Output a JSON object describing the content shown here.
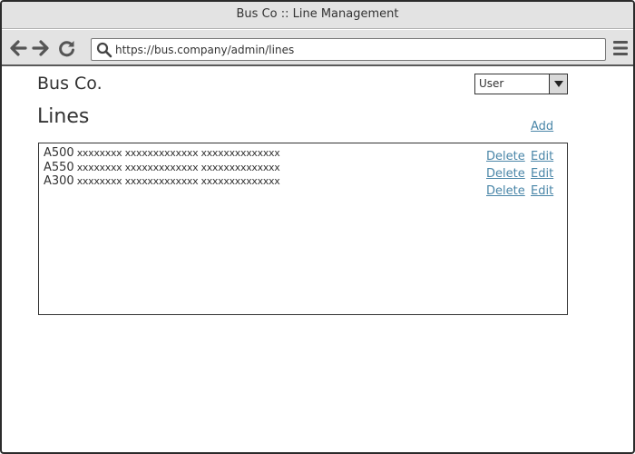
{
  "window": {
    "title": "Bus Co :: Line Management"
  },
  "browser": {
    "url": "https://bus.company/admin/lines"
  },
  "header": {
    "brand": "Bus Co.",
    "role_select": {
      "selected": "User"
    }
  },
  "page": {
    "title": "Lines",
    "add_label": "Add"
  },
  "lines": [
    {
      "code": "A500",
      "description": "xxxxxxxx xxxxxxxxxxxxx xxxxxxxxxxxxxx",
      "delete_label": "Delete",
      "edit_label": "Edit"
    },
    {
      "code": "A550",
      "description": "xxxxxxxx xxxxxxxxxxxxx xxxxxxxxxxxxxx",
      "delete_label": "Delete",
      "edit_label": "Edit"
    },
    {
      "code": "A300",
      "description": "xxxxxxxx xxxxxxxxxxxxx xxxxxxxxxxxxxx",
      "delete_label": "Delete",
      "edit_label": "Edit"
    }
  ],
  "colors": {
    "link": "#4a86a8",
    "chrome": "#e3e3e3",
    "border": "#333333"
  },
  "icons": {
    "back": "arrow-left-icon",
    "forward": "arrow-right-icon",
    "reload": "reload-icon",
    "search": "search-icon",
    "menu": "hamburger-menu-icon",
    "dropdown": "chevron-down-icon"
  }
}
